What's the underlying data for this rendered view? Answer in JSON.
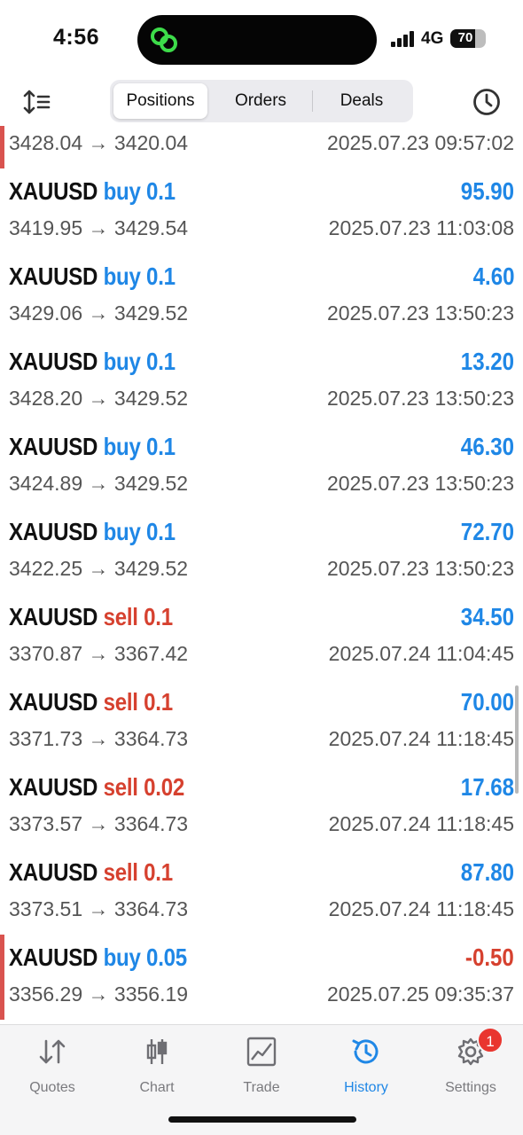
{
  "status": {
    "time": "4:56",
    "network": "4G",
    "battery": "70",
    "battery_level": 0.7
  },
  "toolbar": {
    "tabs": [
      {
        "label": "Positions",
        "active": true
      },
      {
        "label": "Orders",
        "active": false
      },
      {
        "label": "Deals",
        "active": false
      }
    ]
  },
  "trades": [
    {
      "symbol": "",
      "side": "",
      "volume": "",
      "type": "",
      "profit": "",
      "profit_neg": false,
      "prices": "3428.04 → 3420.04",
      "datetime": "2025.07.23 09:57:02",
      "flagged": true
    },
    {
      "symbol": "XAUUSD",
      "side": "buy",
      "volume": "0.1",
      "type": "buy",
      "profit": "95.90",
      "profit_neg": false,
      "prices": "3419.95 → 3429.54",
      "datetime": "2025.07.23 11:03:08",
      "flagged": false
    },
    {
      "symbol": "XAUUSD",
      "side": "buy",
      "volume": "0.1",
      "type": "buy",
      "profit": "4.60",
      "profit_neg": false,
      "prices": "3429.06 → 3429.52",
      "datetime": "2025.07.23 13:50:23",
      "flagged": false
    },
    {
      "symbol": "XAUUSD",
      "side": "buy",
      "volume": "0.1",
      "type": "buy",
      "profit": "13.20",
      "profit_neg": false,
      "prices": "3428.20 → 3429.52",
      "datetime": "2025.07.23 13:50:23",
      "flagged": false
    },
    {
      "symbol": "XAUUSD",
      "side": "buy",
      "volume": "0.1",
      "type": "buy",
      "profit": "46.30",
      "profit_neg": false,
      "prices": "3424.89 → 3429.52",
      "datetime": "2025.07.23 13:50:23",
      "flagged": false
    },
    {
      "symbol": "XAUUSD",
      "side": "buy",
      "volume": "0.1",
      "type": "buy",
      "profit": "72.70",
      "profit_neg": false,
      "prices": "3422.25 → 3429.52",
      "datetime": "2025.07.23 13:50:23",
      "flagged": false
    },
    {
      "symbol": "XAUUSD",
      "side": "sell",
      "volume": "0.1",
      "type": "sell",
      "profit": "34.50",
      "profit_neg": false,
      "prices": "3370.87 → 3367.42",
      "datetime": "2025.07.24 11:04:45",
      "flagged": false
    },
    {
      "symbol": "XAUUSD",
      "side": "sell",
      "volume": "0.1",
      "type": "sell",
      "profit": "70.00",
      "profit_neg": false,
      "prices": "3371.73 → 3364.73",
      "datetime": "2025.07.24 11:18:45",
      "flagged": false
    },
    {
      "symbol": "XAUUSD",
      "side": "sell",
      "volume": "0.02",
      "type": "sell",
      "profit": "17.68",
      "profit_neg": false,
      "prices": "3373.57 → 3364.73",
      "datetime": "2025.07.24 11:18:45",
      "flagged": false
    },
    {
      "symbol": "XAUUSD",
      "side": "sell",
      "volume": "0.1",
      "type": "sell",
      "profit": "87.80",
      "profit_neg": false,
      "prices": "3373.51 → 3364.73",
      "datetime": "2025.07.24 11:18:45",
      "flagged": false
    },
    {
      "symbol": "XAUUSD",
      "side": "buy",
      "volume": "0.05",
      "type": "buy",
      "profit": "-0.50",
      "profit_neg": true,
      "prices": "3356.29 → 3356.19",
      "datetime": "2025.07.25 09:35:37",
      "flagged": true
    }
  ],
  "tabbar": [
    {
      "label": "Quotes",
      "icon": "quotes-arrows-icon",
      "active": false
    },
    {
      "label": "Chart",
      "icon": "candlestick-icon",
      "active": false
    },
    {
      "label": "Trade",
      "icon": "trade-chart-icon",
      "active": false
    },
    {
      "label": "History",
      "icon": "history-clock-icon",
      "active": true
    },
    {
      "label": "Settings",
      "icon": "gear-icon",
      "active": false
    }
  ],
  "settings_badge": "1",
  "colors": {
    "buy": "#1f87e6",
    "sell": "#d6412f",
    "loss_marker": "#d9534f",
    "active_tab": "#1f87e6"
  }
}
